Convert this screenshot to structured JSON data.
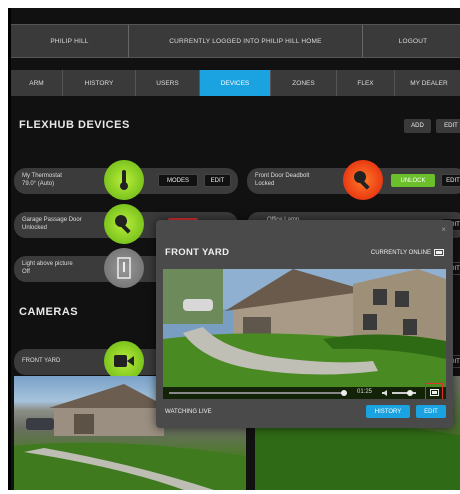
{
  "topbar": {
    "user": "PHILIP HILL",
    "status": "CURRENTLY LOGGED INTO PHILIP HILL HOME",
    "logout": "LOGOUT"
  },
  "nav": {
    "items": [
      "ARM",
      "HISTORY",
      "USERS",
      "DEVICES",
      "ZONES",
      "FLEX",
      "MY DEALER"
    ],
    "active": "DEVICES"
  },
  "devices": {
    "title": "FLEXHUB DEVICES",
    "add_label": "ADD",
    "edit_label": "EDIT",
    "thermostat": {
      "name": "My Thermostat",
      "state": "79.0° (Auto)",
      "modes": "MODES",
      "edit": "EDIT"
    },
    "front_door": {
      "name": "Front Door Deadbolt",
      "state": "Locked",
      "action": "UNLOCK",
      "edit": "EDIT"
    },
    "garage": {
      "name": "Garage Passage Door",
      "state": "Unlocked"
    },
    "office": {
      "name": "Office Lamp",
      "edit": "EDIT"
    },
    "light": {
      "name": "Light above picture",
      "state": "Off",
      "edit": "EDIT"
    }
  },
  "cameras": {
    "title": "CAMERAS",
    "front_yard": "FRONT YARD",
    "edit": "EDIT"
  },
  "modal": {
    "title": "FRONT YARD",
    "online": "CURRENTLY ONLINE",
    "time": "01:25",
    "watching": "WATCHING LIVE",
    "history": "HISTORY",
    "edit": "EDIT",
    "close": "×"
  },
  "colors": {
    "accent": "#1aa3e0",
    "green": "#6abf2a",
    "highlight": "#e03030"
  },
  "icons": {
    "thermometer": "thermometer-icon",
    "key": "key-icon",
    "light": "light-switch-icon",
    "camera": "video-camera-icon"
  }
}
